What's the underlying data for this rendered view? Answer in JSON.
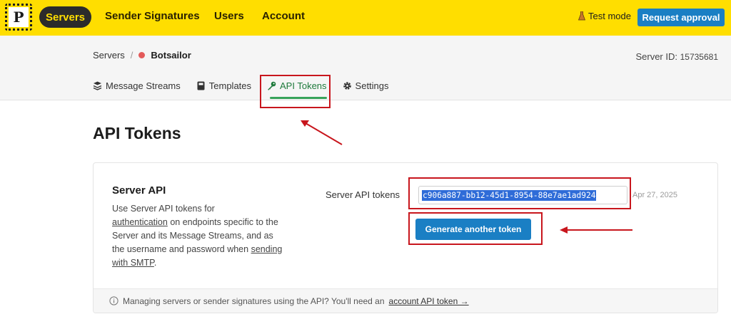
{
  "topnav": {
    "logo_letter": "P",
    "items": [
      {
        "label": "Servers",
        "active": true
      },
      {
        "label": "Sender Signatures",
        "active": false
      },
      {
        "label": "Users",
        "active": false
      },
      {
        "label": "Account",
        "active": false
      }
    ],
    "test_mode_label": "Test mode",
    "request_button": "Request approval"
  },
  "breadcrumb": {
    "root": "Servers",
    "separator": "/",
    "current": "Botsailor",
    "status_color": "#e35a5a"
  },
  "server_id": {
    "label": "Server ID:",
    "value": "15735681"
  },
  "tabs": [
    {
      "label": "Message Streams",
      "icon": "streams-icon",
      "active": false
    },
    {
      "label": "Templates",
      "icon": "template-icon",
      "active": false
    },
    {
      "label": "API Tokens",
      "icon": "key-icon",
      "active": true
    },
    {
      "label": "Settings",
      "icon": "gear-icon",
      "active": false
    }
  ],
  "page_title": "API Tokens",
  "card": {
    "title": "Server API",
    "desc_1": "Use Server API tokens for",
    "desc_link_1": "authentication",
    "desc_2": " on endpoints specific to the Server and its Message Streams, and as the username and password when ",
    "desc_link_2": "sending with SMTP",
    "desc_3": ".",
    "token_label": "Server API tokens",
    "token_value": "c906a887-bb12-45d1-8954-88e7ae1ad924",
    "token_date": "Apr 27, 2025",
    "generate_button": "Generate another token",
    "footer_text": "Managing servers or sender signatures using the API? You'll need an",
    "footer_link": "account API token →"
  },
  "colors": {
    "brand_yellow": "#ffde00",
    "primary_blue": "#1a7fc4",
    "annotation_red": "#c8161d",
    "active_tab_green": "#37a35a"
  }
}
